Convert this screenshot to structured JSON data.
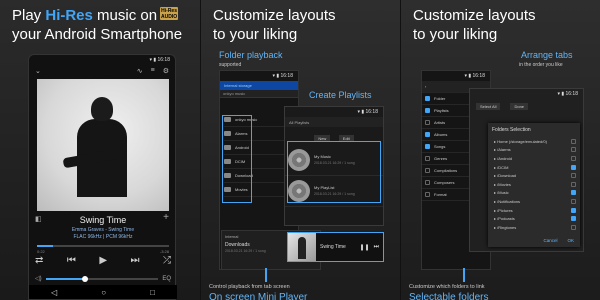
{
  "panel1": {
    "headline_pre": "Play ",
    "headline_hi": "Hi-Res",
    "headline_post": " music on",
    "headline_line2": "your Android Smartphone",
    "badge": "Hi-Res AUDIO",
    "status_time": "16:18",
    "track_title": "Swing Time",
    "track_artist": "Emma Graves - Swing Time",
    "track_format": "FLAC 96kHz | PCM 96kHz",
    "time_elapsed": "0:22",
    "time_total": "-3:28",
    "progress": 0.12,
    "volume": 0.35,
    "eq_label": "EQ"
  },
  "panel2": {
    "headline_line1": "Customize layouts",
    "headline_line2": "to your liking",
    "folder_callout": "Folder playback",
    "folder_sub": "supported",
    "playlists_callout": "Create Playlists",
    "internal_storage": "Internal storage",
    "playlist_tab": "All Playlists",
    "folders": [
      "Alarms",
      "Android",
      "DCIM",
      "Download",
      "Movies"
    ],
    "folder_top": "onkyo music",
    "playlist_btn_new": "New",
    "playlist_btn_edit": "Edit",
    "playlists": [
      {
        "name": "My Music",
        "meta": "2018.03.21 16:29 / 1 song"
      },
      {
        "name": "My PlayList",
        "meta": "2018.03.21 16:29 / 1 song"
      }
    ],
    "downloads_title": "Downloads",
    "downloads_meta": "2018.03.21 16:29 / 1 song",
    "mini_title": "Swing Time",
    "bottom_caption": "Control playback from tab screen",
    "bottom_big": "On screen Mini Player"
  },
  "panel3": {
    "headline_line1": "Customize layouts",
    "headline_line2": "to your liking",
    "tabs_callout": "Arrange tabs",
    "tabs_sub": "in the order you like",
    "tab_rows": [
      "Folder",
      "Playlists",
      "Artists",
      "Albums",
      "Songs",
      "Genres",
      "Compilations",
      "Composers",
      "Format"
    ],
    "tab_checked": [
      true,
      true,
      false,
      true,
      true,
      false,
      false,
      false,
      false
    ],
    "dialog_title": "Folders Selection",
    "dialog_rows": [
      "Home (/storage/emulated/0)",
      "/Alarms",
      "/Android",
      "/DCIM",
      "/Download",
      "/Movies",
      "/Music",
      "/Notifications",
      "/Pictures",
      "/Podcasts",
      "/Ringtones"
    ],
    "dialog_checked": [
      false,
      false,
      false,
      true,
      false,
      false,
      true,
      false,
      true,
      true,
      false
    ],
    "dialog_cancel": "Cancel",
    "dialog_ok": "OK",
    "bottom_caption": "Customize which folders to link",
    "bottom_big": "Selectable folders"
  }
}
